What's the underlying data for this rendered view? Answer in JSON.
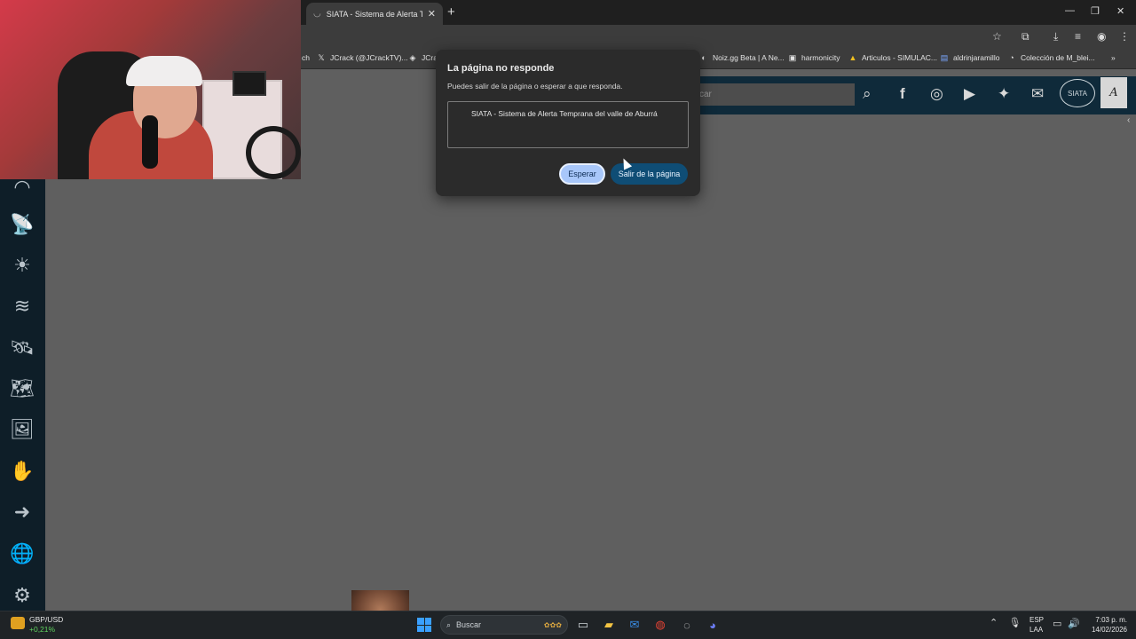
{
  "browser": {
    "tab_title": "SIATA - Sistema de Alerta Temprana del valle de Aburrá",
    "new_tab": "+",
    "bookmarks": [
      {
        "label": "ch",
        "icon": "bookmark-icon"
      },
      {
        "label": "JCrack (@JCrackTV)...",
        "icon": "x-logo-icon"
      },
      {
        "label": "JCra",
        "icon": "bookmark-icon"
      },
      {
        "label": "Noiz.gg Beta | A Ne...",
        "icon": "noiz-icon"
      },
      {
        "label": "harmonicity",
        "icon": "harmonicity-icon"
      },
      {
        "label": "Articulos - SIMULAC...",
        "icon": "drive-icon"
      },
      {
        "label": "aldrinjaramillo",
        "icon": "app-icon"
      },
      {
        "label": "Colección de M_blei...",
        "icon": "collection-icon"
      }
    ],
    "bookmarks_overflow": "»"
  },
  "site": {
    "search_placeholder": "car",
    "siata_logo": "SIATA"
  },
  "dialog": {
    "title": "La página no responde",
    "description": "Puedes salir de la página o esperar a que responda.",
    "page_item": "SIATA - Sistema de Alerta Temprana del valle de Aburrá",
    "wait_label": "Esperar",
    "exit_label": "Salir de la página"
  },
  "taskbar": {
    "ticker_pair": "GBP/USD",
    "ticker_change": "+0,21%",
    "search_label": "Buscar",
    "lang_line1": "ESP",
    "lang_line2": "LAA",
    "time": "7:03 p. m.",
    "date": "14/02/2026"
  },
  "colors": {
    "accent": "#a8c7fa",
    "primary_button": "#0f4d75",
    "site_header": "#0f2a3a",
    "sidebar": "#0e1e28"
  }
}
